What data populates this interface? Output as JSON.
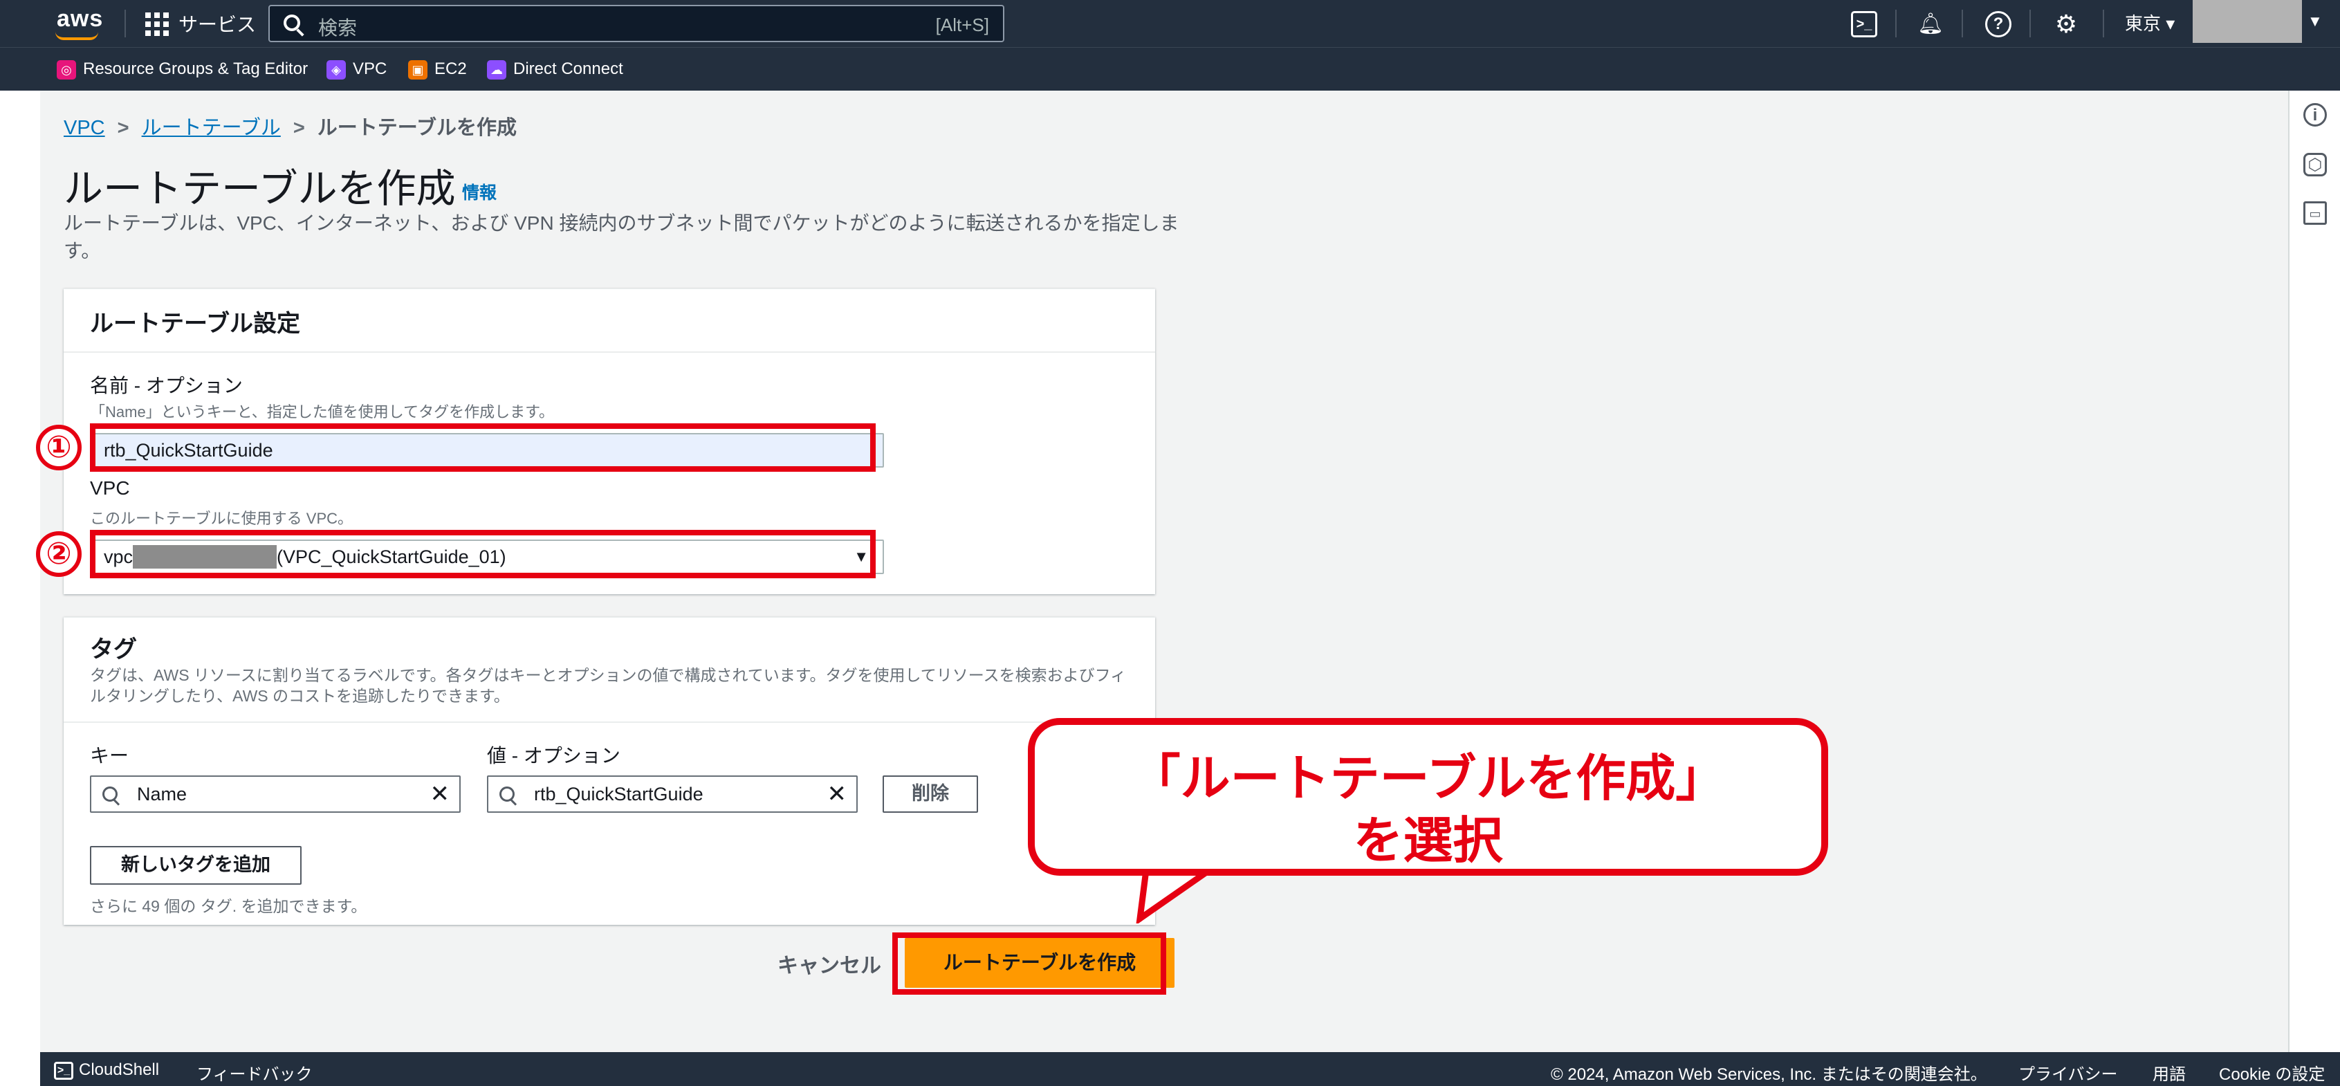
{
  "topnav": {
    "logo": "aws",
    "services_label": "サービス",
    "search_placeholder": "検索",
    "search_shortcut": "[Alt+S]",
    "region_label": "東京 ▾",
    "icons": [
      "cloudshell-icon",
      "bell-icon",
      "help-icon",
      "settings-icon"
    ],
    "favorites": [
      {
        "label": "Resource Groups & Tag Editor",
        "icon": "resource-groups-icon",
        "color": "#e7157b"
      },
      {
        "label": "VPC",
        "icon": "vpc-icon",
        "color": "#8c4fff"
      },
      {
        "label": "EC2",
        "icon": "ec2-icon",
        "color": "#ed7100"
      },
      {
        "label": "Direct Connect",
        "icon": "direct-connect-icon",
        "color": "#8c4fff"
      }
    ]
  },
  "breadcrumb": {
    "items": [
      "VPC",
      "ルートテーブル"
    ],
    "current": "ルートテーブルを作成"
  },
  "header": {
    "title": "ルートテーブルを作成",
    "info_link": "情報",
    "description": "ルートテーブルは、VPC、インターネット、および VPN 接続内のサブネット間でパケットがどのように転送されるかを指定します。"
  },
  "settings_panel": {
    "title": "ルートテーブル設定",
    "name_label": "名前 - オプション",
    "name_hint": "「Name」というキーと、指定した値を使用してタグを作成します。",
    "name_value": "rtb_QuickStartGuide",
    "vpc_label": "VPC",
    "vpc_hint": "このルートテーブルに使用する VPC。",
    "vpc_prefix": "vpc",
    "vpc_suffix": "(VPC_QuickStartGuide_01)"
  },
  "annotations": {
    "step1": "①",
    "step2": "②",
    "callout_line1": "「ルートテーブルを作成」",
    "callout_line2": "を選択",
    "highlight_color": "#e60012"
  },
  "tags_panel": {
    "title": "タグ",
    "description": "タグは、AWS リソースに割り当てるラベルです。各タグはキーとオプションの値で構成されています。タグを使用してリソースを検索およびフィルタリングしたり、AWS のコストを追跡したりできます。",
    "key_label": "キー",
    "value_label": "値 - オプション",
    "key_value": "Name",
    "value_value": "rtb_QuickStartGuide",
    "remove_button": "削除",
    "add_button": "新しいタグを追加",
    "footnote": "さらに 49 個の タグ. を追加できます。"
  },
  "actions": {
    "cancel": "キャンセル",
    "create": "ルートテーブルを作成",
    "primary_color": "#ff9900"
  },
  "footer": {
    "cloudshell": "CloudShell",
    "feedback": "フィードバック",
    "copyright": "© 2024, Amazon Web Services, Inc. またはその関連会社。",
    "privacy": "プライバシー",
    "terms": "用語",
    "cookie": "Cookie の設定"
  }
}
